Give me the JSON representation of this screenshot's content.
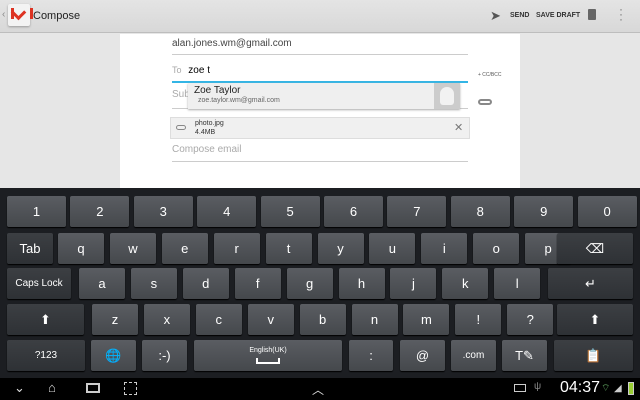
{
  "action_bar": {
    "title": "Compose",
    "send": "SEND",
    "save_draft": "SAVE DRAFT"
  },
  "compose": {
    "from": "alan.jones.wm@gmail.com",
    "to_label": "To",
    "to_value": "zoe t",
    "cc_bcc": "+ CC/BCC",
    "subject_placeholder": "Sub",
    "body_placeholder": "Compose email"
  },
  "suggestion": {
    "name": "Zoe Taylor",
    "email": "zoe.taylor.wm@gmail.com"
  },
  "attachment": {
    "name": "photo.jpg",
    "size": "4.4MB"
  },
  "keyboard": {
    "rows": [
      [
        "1",
        "2",
        "3",
        "4",
        "5",
        "6",
        "7",
        "8",
        "9",
        "0"
      ],
      [
        "Tab",
        "q",
        "w",
        "e",
        "r",
        "t",
        "y",
        "u",
        "i",
        "o",
        "p",
        "⌫"
      ],
      [
        "Caps Lock",
        "a",
        "s",
        "d",
        "f",
        "g",
        "h",
        "j",
        "k",
        "l",
        "↵"
      ],
      [
        "⬆",
        "z",
        "x",
        "c",
        "v",
        "b",
        "n",
        "m",
        "!",
        "?",
        "⬆"
      ],
      [
        "?123",
        "🌐",
        ":-)",
        "English(UK)",
        ":",
        "@",
        ".com",
        "T✎",
        "📋"
      ]
    ]
  },
  "status_bar": {
    "time": "04:37"
  }
}
